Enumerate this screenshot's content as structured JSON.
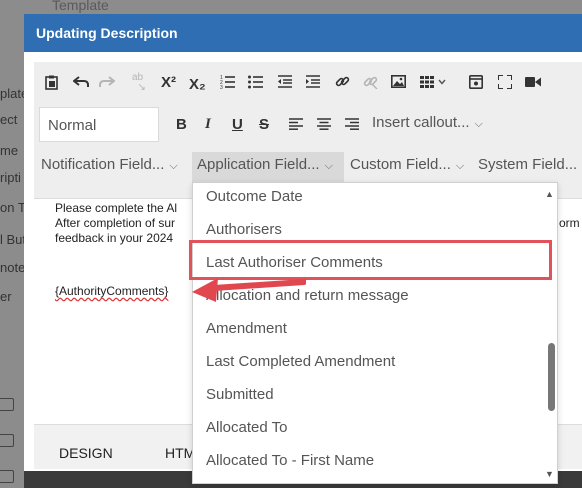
{
  "background": {
    "top_label": "Template",
    "side_items": [
      "plate",
      "ect",
      "me",
      "ripti",
      "on To",
      "l But",
      "note",
      "er"
    ]
  },
  "dialog": {
    "title": "Updating Description"
  },
  "toolbar": {
    "icons": [
      "paste-icon",
      "undo-icon",
      "redo-icon",
      "spellcheck-icon",
      "superscript-icon",
      "subscript-icon",
      "ordered-list-icon",
      "unordered-list-icon",
      "outdent-icon",
      "indent-icon",
      "link-icon",
      "unlink-icon",
      "image-icon",
      "table-icon",
      "source-icon",
      "fullscreen-icon",
      "video-icon"
    ],
    "superscript_label": "X²",
    "subscript_label": "X₂",
    "format_value": "Normal",
    "bold_label": "B",
    "italic_label": "I",
    "underline_label": "U",
    "strike_label": "S",
    "insert_callout": "Insert callout...",
    "notification_fields": "Notification Field...",
    "application_fields": "Application Field...",
    "custom_fields": "Custom Field...",
    "system_fields": "System Field..."
  },
  "editor": {
    "line1": "Please complete the Al",
    "line2": "After completion of sur",
    "line2_right": "orm",
    "line3": "feedback in your 2024",
    "token": "{AuthorityComments}"
  },
  "tabs": {
    "design": "DESIGN",
    "html": "HTM"
  },
  "dropdown": {
    "items": [
      "Outcome Date",
      "Authorisers",
      "Last Authoriser Comments",
      "Allocation and return message",
      "Amendment",
      "Last Completed Amendment",
      "Submitted",
      "Allocated To",
      "Allocated To - First Name"
    ],
    "highlighted_index": 2
  },
  "colors": {
    "header": "#2f6eb2",
    "highlight": "#e2525a",
    "arrow": "#e0474f"
  }
}
